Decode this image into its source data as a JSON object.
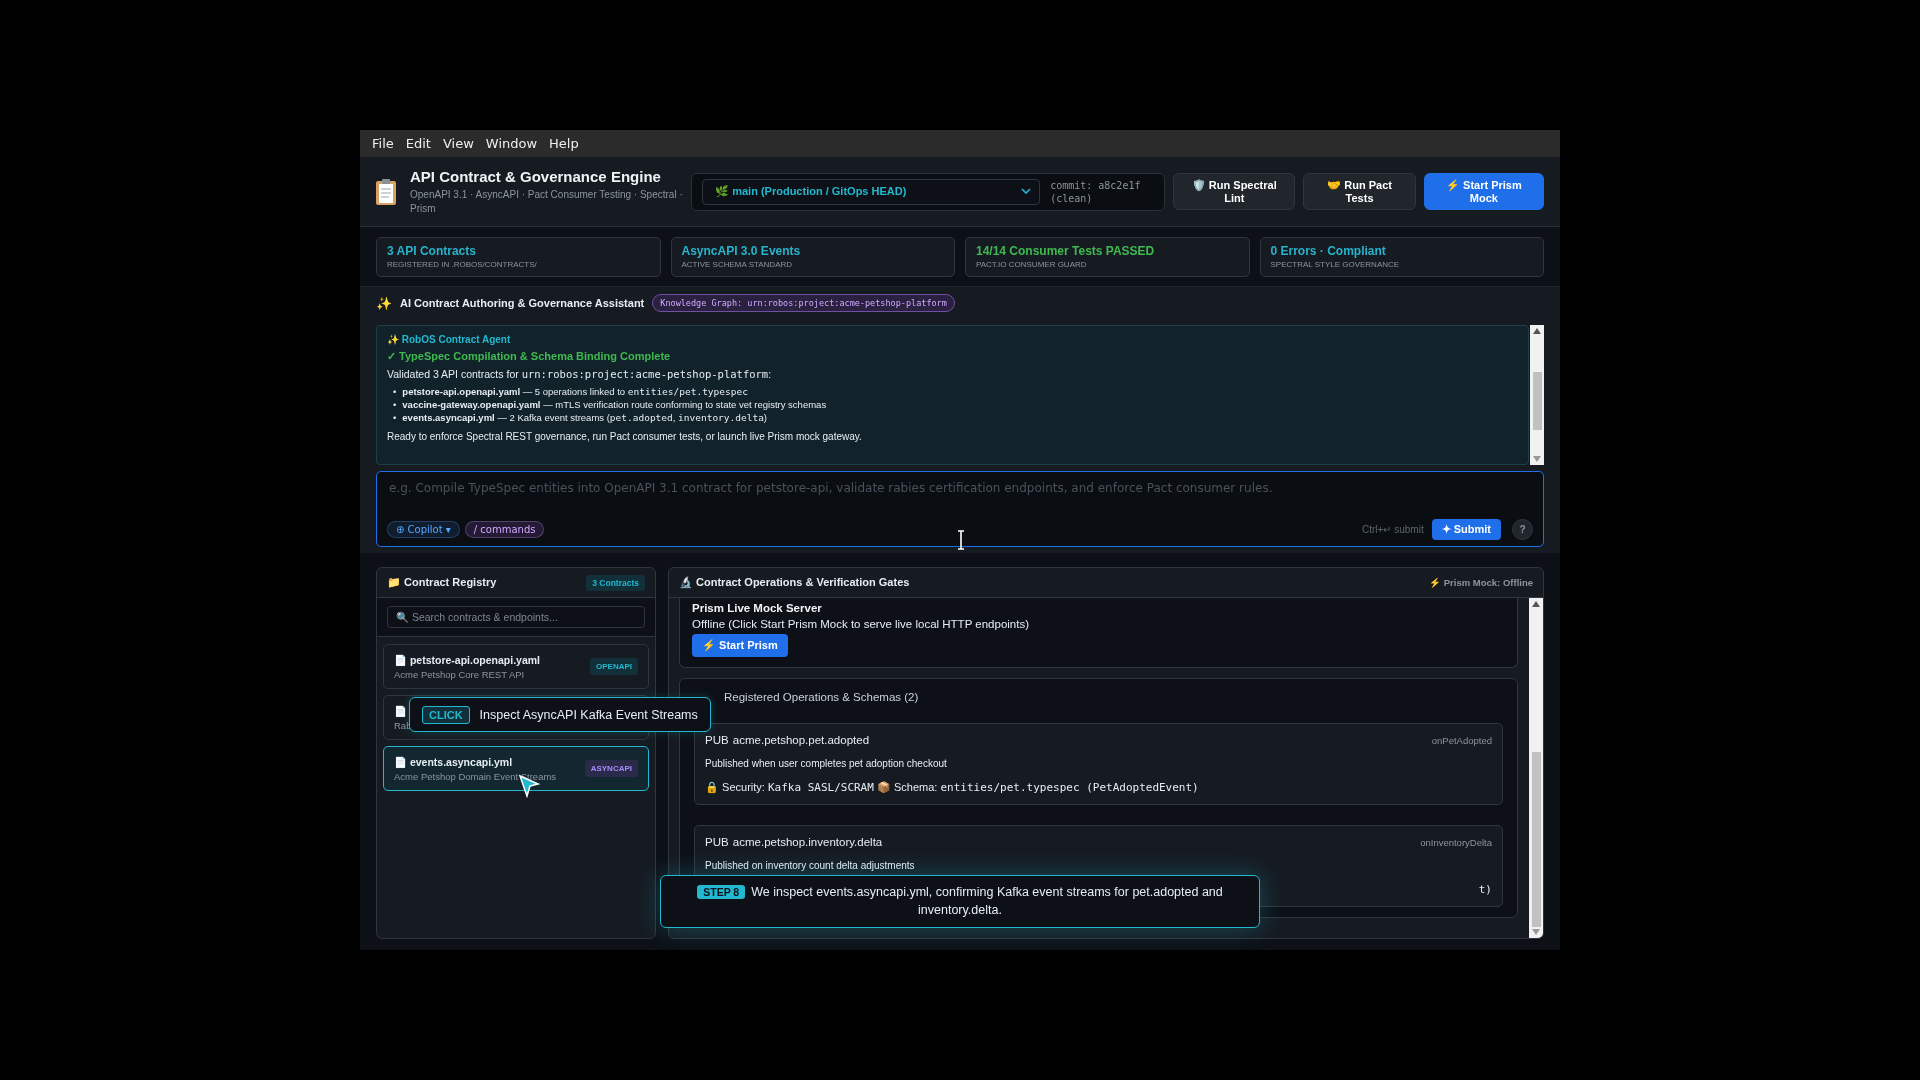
{
  "menu": [
    "File",
    "Edit",
    "View",
    "Window",
    "Help"
  ],
  "header": {
    "title": "API Contract & Governance Engine",
    "subtitle": "OpenAPI 3.1 · AsyncAPI · Pact Consumer Testing · Spectral · Prism",
    "branch": "🌿 main (Production / GitOps HEAD)",
    "commit": "commit: a8c2e1f (clean)",
    "buttons": [
      {
        "label": "🛡️ Run Spectral Lint",
        "primary": false
      },
      {
        "label": "🤝 Run Pact Tests",
        "primary": false
      },
      {
        "label": "⚡ Start Prism Mock",
        "primary": true
      }
    ]
  },
  "stats": [
    {
      "value": "3 API Contracts",
      "label": "REGISTERED IN .ROBOS/CONTRACTS/",
      "color": "#27b3cb"
    },
    {
      "value": "AsyncAPI 3.0 Events",
      "label": "ACTIVE SCHEMA STANDARD",
      "color": "#27b3cb"
    },
    {
      "value": "14/14 Consumer Tests PASSED",
      "label": "PACT.IO CONSUMER GUARD",
      "color": "#3fb950"
    },
    {
      "value": "0 Errors · Compliant",
      "label": "SPECTRAL STYLE GOVERNANCE",
      "color": "#27b3cb"
    }
  ],
  "assistant": {
    "icon": "✨",
    "title": "AI Contract Authoring & Governance Assistant",
    "graph_chip": "Knowledge Graph: urn:robos:project:acme-petshop-platform",
    "agent": "✨ RobOS Contract Agent",
    "status": "✓ TypeSpec Compilation & Schema Binding Complete",
    "intro": [
      {
        "kind": "plain",
        "text": "Validated 3 API contracts for "
      },
      {
        "kind": "code",
        "text": "urn:robos:project:acme-petshop-platform"
      },
      {
        "kind": "plain",
        "text": ":"
      }
    ],
    "bullets": [
      {
        "marker": "•",
        "parts": [
          {
            "kind": "bold",
            "text": "petstore-api.openapi.yaml"
          },
          {
            "kind": "plain",
            "text": " — 5 operations linked to "
          },
          {
            "kind": "code",
            "text": "entities/pet.typespec"
          }
        ]
      },
      {
        "marker": "•",
        "parts": [
          {
            "kind": "bold",
            "text": "vaccine-gateway.openapi.yaml"
          },
          {
            "kind": "plain",
            "text": " — mTLS verification route conforming to state vet registry schemas"
          }
        ]
      },
      {
        "marker": "•",
        "parts": [
          {
            "kind": "bold",
            "text": "events.asyncapi.yml"
          },
          {
            "kind": "plain",
            "text": " — 2 Kafka event streams ("
          },
          {
            "kind": "code",
            "text": "pet.adopted"
          },
          {
            "kind": "plain",
            "text": ", "
          },
          {
            "kind": "code",
            "text": "inventory.delta"
          },
          {
            "kind": "plain",
            "text": ")"
          }
        ]
      }
    ],
    "outro": "Ready to enforce Spectral REST governance, run Pact consumer tests, or launch live Prism mock gateway."
  },
  "prompt": {
    "placeholder": "e.g. Compile TypeSpec entities into OpenAPI 3.1 contract for petstore-api, validate rabies certification endpoints, and enforce Pact consumer rules.",
    "mode": "⊕ Copilot ▾",
    "commands": "/ commands",
    "hint": "Ctrl+↵ submit",
    "submit": "✦ Submit",
    "help": "?"
  },
  "registry": {
    "title": "📁 Contract Registry",
    "count": "3 Contracts",
    "search_placeholder": "🔍 Search contracts & endpoints...",
    "items": [
      {
        "name": "📄 petstore-api.openapi.yaml",
        "description": "Acme Petshop Core REST API",
        "tag": "OPENAPI",
        "kind": "openapi",
        "selected": false
      },
      {
        "name": "📄",
        "description": "Rab",
        "selected": false
      },
      {
        "name": "📄 events.asyncapi.yml",
        "description": "Acme Petshop Domain Event Streams",
        "tag": "ASYNCAPI",
        "kind": "asyncapi",
        "selected": true
      }
    ]
  },
  "operations": {
    "title": "🔬 Contract Operations & Verification Gates",
    "status": "⚡ Prism Mock: Offline",
    "mock": {
      "title": "Prism Live Mock Server",
      "text": "Offline (Click Start Prism Mock to serve live local HTTP endpoints)",
      "button": "⚡ Start Prism"
    },
    "registered_title": "Registered Operations & Schemas (2)",
    "ops": [
      {
        "method": "PUB",
        "channel": "acme.petshop.pet.adopted",
        "operation_id": "onPetAdopted",
        "description": "Published when user completes pet adoption checkout",
        "meta": [
          {
            "kind": "plain",
            "text": "🔒 Security: "
          },
          {
            "kind": "code",
            "text": "Kafka SASL/SCRAM"
          },
          {
            "kind": "plain",
            "text": " 📦 Schema: "
          },
          {
            "kind": "code",
            "text": "entities/pet.typespec (PetAdoptedEvent)"
          }
        ]
      },
      {
        "method": "PUB",
        "channel": "acme.petshop.inventory.delta",
        "operation_id": "onInventoryDelta",
        "description": "Published on inventory count delta adjustments",
        "meta": [
          {
            "kind": "code",
            "text": "t)"
          }
        ]
      }
    ]
  },
  "tour": {
    "click_badge": "CLICK",
    "click_text": "Inspect AsyncAPI Kafka Event Streams",
    "step_badge": "STEP 8",
    "step_text": "We inspect events.asyncapi.yml, confirming Kafka event streams for pet.adopted and inventory.delta."
  }
}
